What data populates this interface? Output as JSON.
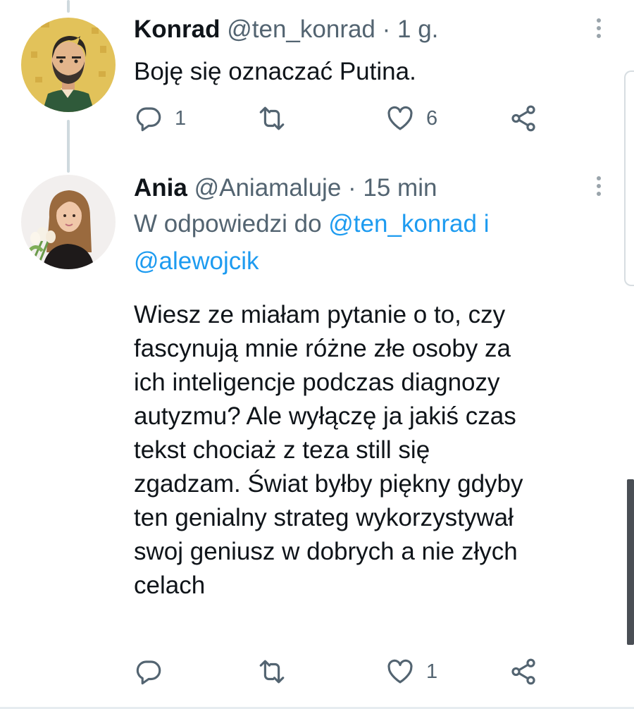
{
  "tweets": [
    {
      "display_name": "Konrad",
      "handle": "@ten_konrad",
      "separator": "·",
      "time": "1 g.",
      "text": "Boję się oznaczać Putina.",
      "replies": "1",
      "retweets": "",
      "likes": "6"
    },
    {
      "display_name": "Ania",
      "handle": "@Aniamaluje",
      "separator": "·",
      "time": "15 min",
      "reply_prefix": "W odpowiedzi do",
      "reply_mention_1": "@ten_konrad",
      "reply_conjunction": "i",
      "reply_mention_2": "@alewojcik",
      "text_lines": [
        "Wiesz ze miałam pytanie o to, czy",
        "fascynują mnie różne złe osoby za",
        "ich inteligencje podczas diagnozy",
        "autyzmu? Ale wyłączę ja jakiś czas",
        "tekst chociaż z teza still się",
        "zgadzam. Świat byłby piękny gdyby",
        "ten genialny strateg wykorzystywał",
        "swoj geniusz w dobrych a nie złych",
        "celach"
      ],
      "replies": "",
      "retweets": "",
      "likes": "1"
    }
  ],
  "icons": {
    "reply": "reply-icon",
    "retweet": "retweet-icon",
    "like": "heart-icon",
    "share": "share-icon",
    "more": "more-vertical-icon"
  },
  "colors": {
    "link": "#1d9bf0",
    "secondary_text": "#536471",
    "primary_text": "#0f1419",
    "thread_line": "#cfd9de"
  }
}
